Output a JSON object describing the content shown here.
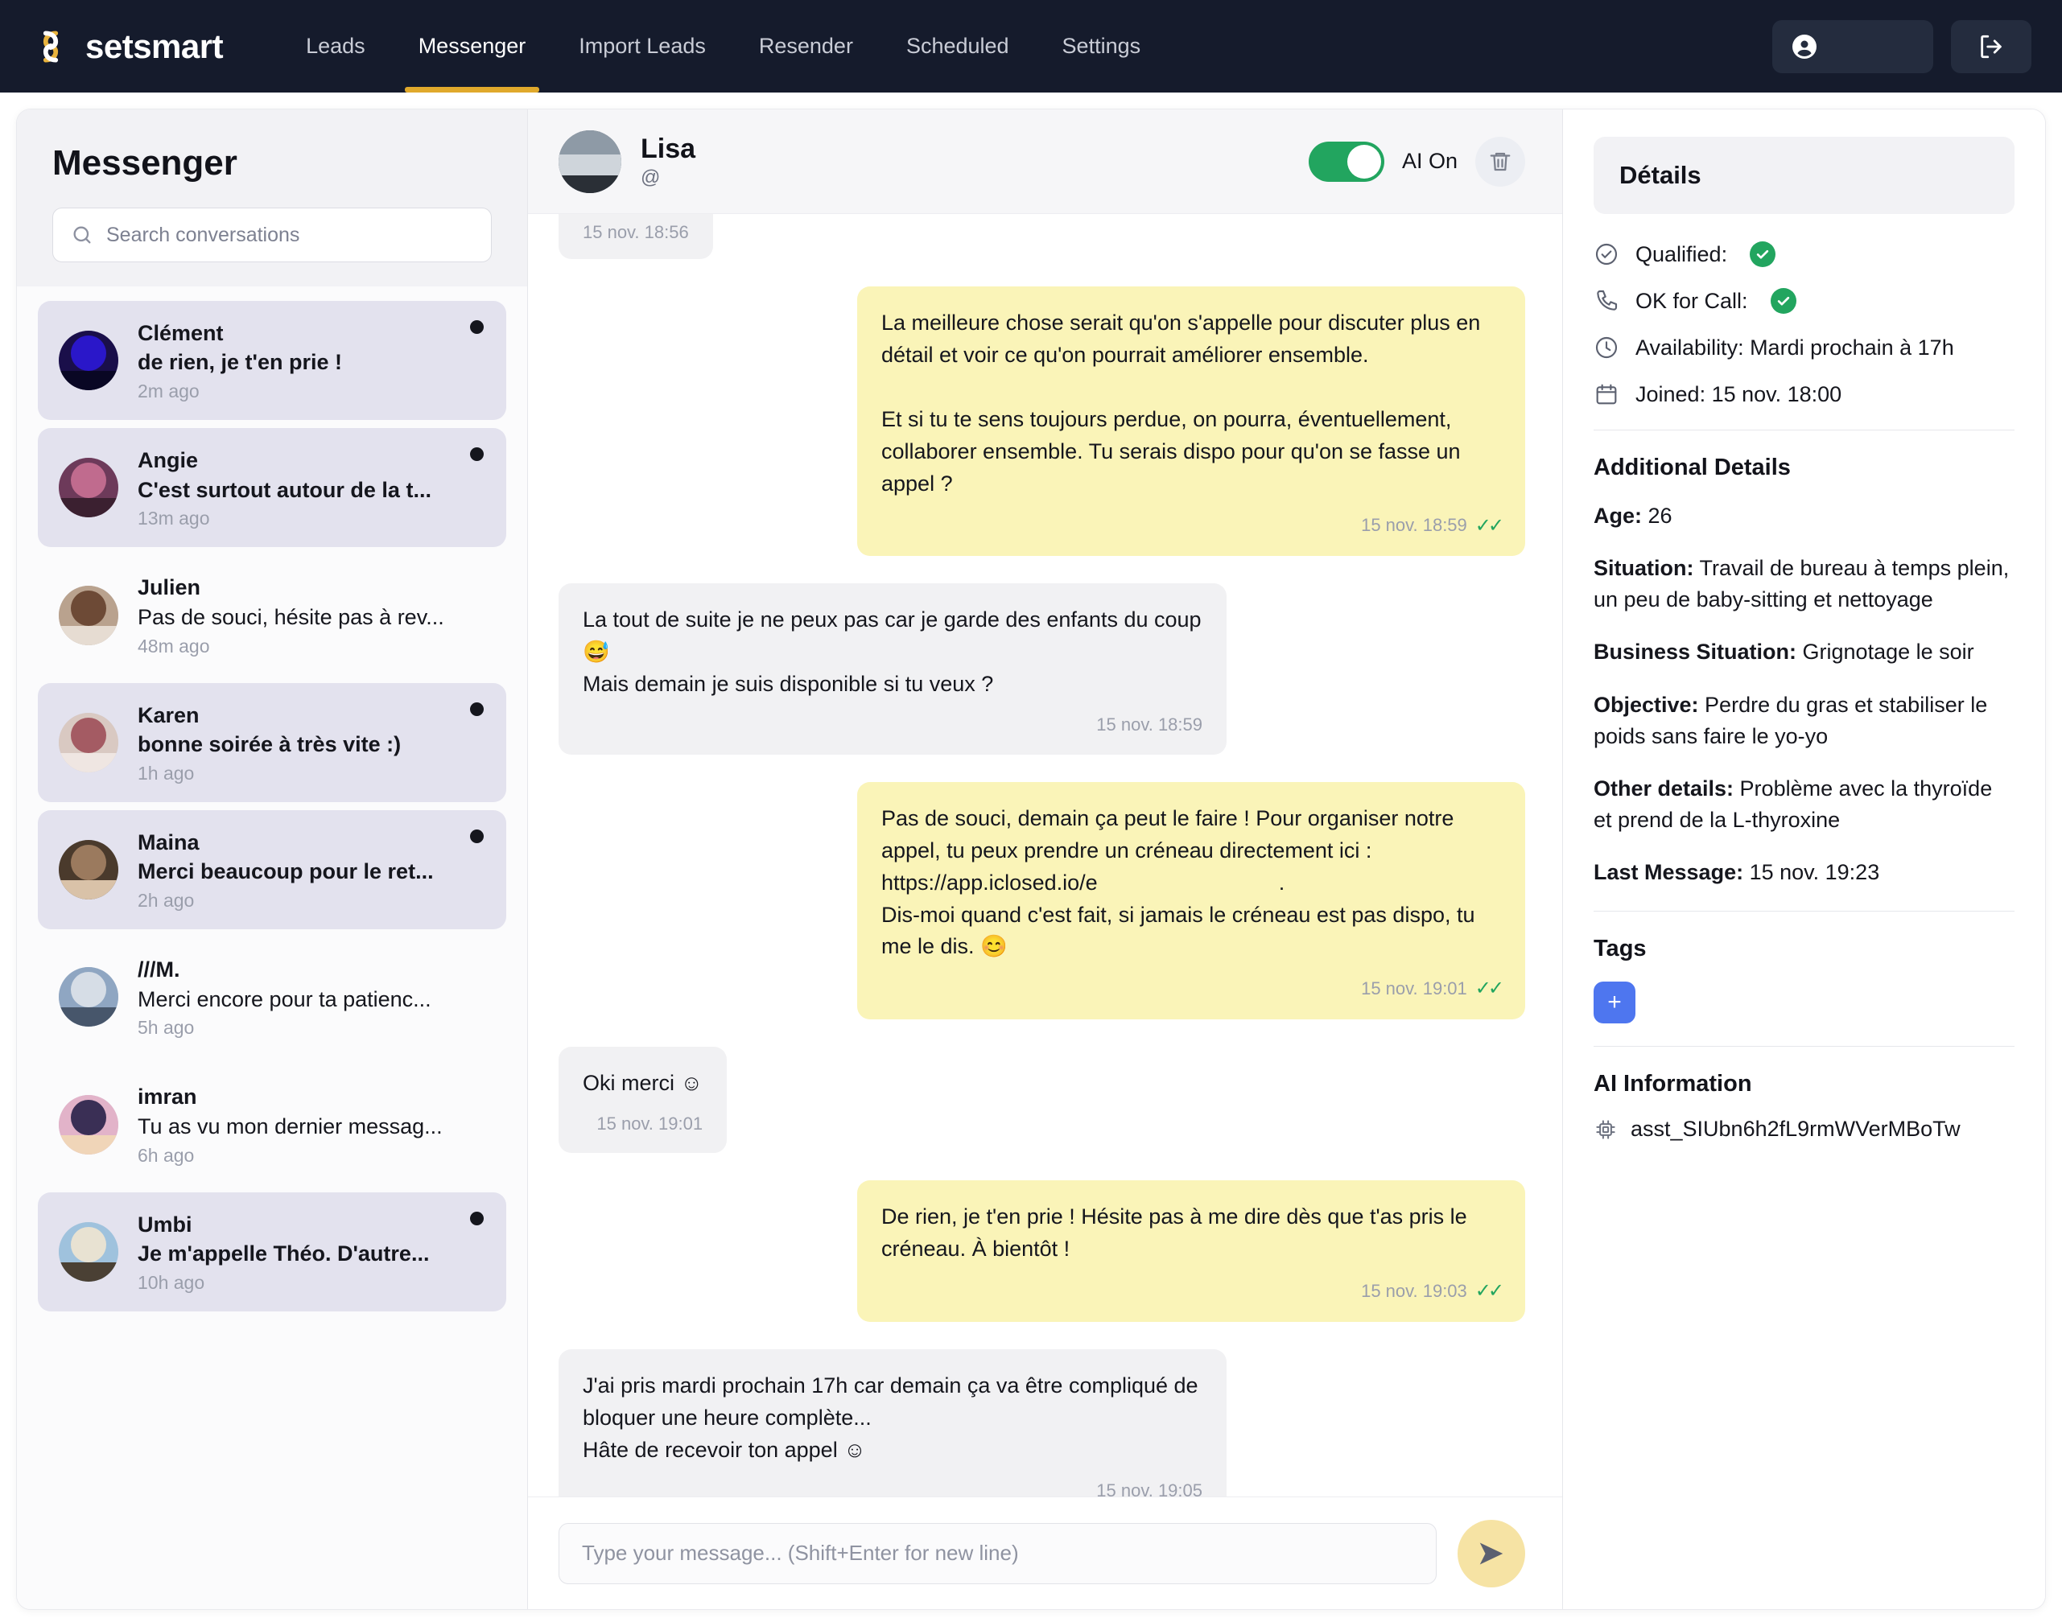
{
  "brand": {
    "name_part1": "set",
    "name_part2": "smart",
    "logo_icon": "setsmart-logo-icon"
  },
  "nav": {
    "items": [
      {
        "label": "Leads",
        "active": false
      },
      {
        "label": "Messenger",
        "active": true
      },
      {
        "label": "Import Leads",
        "active": false
      },
      {
        "label": "Resender",
        "active": false
      },
      {
        "label": "Scheduled",
        "active": false
      },
      {
        "label": "Settings",
        "active": false
      }
    ],
    "user_chip_icon": "user-circle-icon",
    "logout_icon": "logout-icon"
  },
  "sidebar": {
    "title": "Messenger",
    "search_placeholder": "Search conversations",
    "search_value": "",
    "search_icon": "search-icon",
    "conversations": [
      {
        "name": "Clément",
        "preview": "de rien, je t'en prie !",
        "time": "2m ago",
        "unread": true
      },
      {
        "name": "Angie",
        "preview": "C'est surtout autour de la t...",
        "time": "13m ago",
        "unread": true
      },
      {
        "name": "Julien",
        "preview": "Pas de souci, hésite pas à rev...",
        "time": "48m ago",
        "unread": false
      },
      {
        "name": "Karen",
        "preview": "bonne soirée à très vite :)",
        "time": "1h ago",
        "unread": true
      },
      {
        "name": "Maina",
        "preview": "Merci beaucoup pour le ret...",
        "time": "2h ago",
        "unread": true
      },
      {
        "name": "///M.",
        "preview": "Merci encore pour ta patienc...",
        "time": "5h ago",
        "unread": false
      },
      {
        "name": "imran",
        "preview": "Tu as vu mon dernier messag...",
        "time": "6h ago",
        "unread": false
      },
      {
        "name": "Umbi",
        "preview": "Je m'appelle Théo. D'autre...",
        "time": "10h ago",
        "unread": true
      }
    ]
  },
  "chat": {
    "contact_name": "Lisa",
    "contact_handle": "@",
    "ai_toggle_label": "AI On",
    "ai_toggle_on": true,
    "trash_icon": "trash-icon",
    "clipped_message_time": "15 nov. 18:56",
    "messages": [
      {
        "side": "out",
        "text": "La meilleure chose serait qu'on s'appelle pour discuter plus en détail et voir ce qu'on pourrait améliorer ensemble.\n\nEt si tu te sens toujours perdue, on pourra, éventuellement, collaborer ensemble. Tu serais dispo pour qu'on se fasse un appel ?",
        "time": "15 nov. 18:59",
        "read": true
      },
      {
        "side": "in",
        "text": "La tout de suite je ne peux pas car je garde des enfants du coup 😅\nMais demain je suis disponible si tu veux ?",
        "time": "15 nov. 18:59",
        "read": false
      },
      {
        "side": "out",
        "text": "Pas de souci, demain ça peut le faire ! Pour organiser notre appel, tu peux prendre un créneau directement ici : https://app.iclosed.io/e                              .\nDis-moi quand c'est fait, si jamais le créneau est pas dispo, tu me le dis. 😊",
        "time": "15 nov. 19:01",
        "read": true
      },
      {
        "side": "in",
        "text": "Oki merci ☺",
        "time": "15 nov. 19:01",
        "read": false
      },
      {
        "side": "out",
        "text": "De rien, je t'en prie ! Hésite pas à me dire dès que t'as pris le créneau. À bientôt !",
        "time": "15 nov. 19:03",
        "read": true
      },
      {
        "side": "in",
        "text": "J'ai pris mardi prochain 17h car demain ça va être compliqué de bloquer une heure complète...\nHâte de recevoir ton appel ☺",
        "time": "15 nov. 19:05",
        "read": false
      }
    ],
    "composer_placeholder": "Type your message... (Shift+Enter for new line)",
    "composer_value": "",
    "send_icon": "send-icon"
  },
  "details": {
    "header": "Détails",
    "rows": [
      {
        "icon": "check-circle-icon",
        "label": "Qualified:",
        "badge": true
      },
      {
        "icon": "phone-icon",
        "label": "OK for Call:",
        "badge": true
      },
      {
        "icon": "clock-icon",
        "label": "Availability: Mardi prochain à 17h",
        "badge": false
      },
      {
        "icon": "calendar-icon",
        "label": "Joined: 15 nov. 18:00",
        "badge": false
      }
    ],
    "additional_title": "Additional Details",
    "fields": [
      {
        "key": "Age:",
        "value": " 26"
      },
      {
        "key": "Situation:",
        "value": " Travail de bureau à temps plein, un peu de baby-sitting et nettoyage"
      },
      {
        "key": "Business Situation:",
        "value": " Grignotage le soir"
      },
      {
        "key": "Objective:",
        "value": " Perdre du gras et stabiliser le poids sans faire le yo-yo"
      },
      {
        "key": "Other details:",
        "value": " Problème avec la thyroïde et prend de la L-thyroxine"
      },
      {
        "key": "Last Message:",
        "value": " 15 nov. 19:23"
      }
    ],
    "tags_title": "Tags",
    "tag_add_label": "+",
    "ai_title": "AI Information",
    "ai_chip_icon": "cpu-chip-icon",
    "ai_assistant_id": "asst_SIUbn6h2fL9rmWVerMBoTw"
  },
  "colors": {
    "nav_bg": "#151b2c",
    "accent_gold": "#e0a92c",
    "outgoing_bubble": "#faf4b8",
    "incoming_bubble": "#f1f1f3",
    "toggle_on": "#22a55f",
    "tag_add": "#4e76ef",
    "unread_row": "#e3e2ee"
  }
}
